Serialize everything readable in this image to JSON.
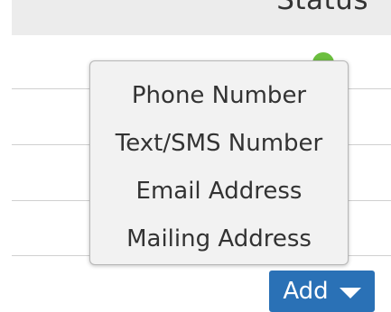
{
  "table": {
    "status_header": "Status"
  },
  "status_icon": "check-circle-icon",
  "colors": {
    "accent": "#2a71b6",
    "status_ok": "#6cbf3f",
    "menu_background": "#f2f2f2"
  },
  "dropdown": {
    "items": [
      {
        "label": "Phone Number"
      },
      {
        "label": "Text/SMS Number"
      },
      {
        "label": "Email Address"
      },
      {
        "label": "Mailing Address"
      }
    ]
  },
  "add_button": {
    "label": "Add",
    "icon": "caret-down-icon"
  }
}
